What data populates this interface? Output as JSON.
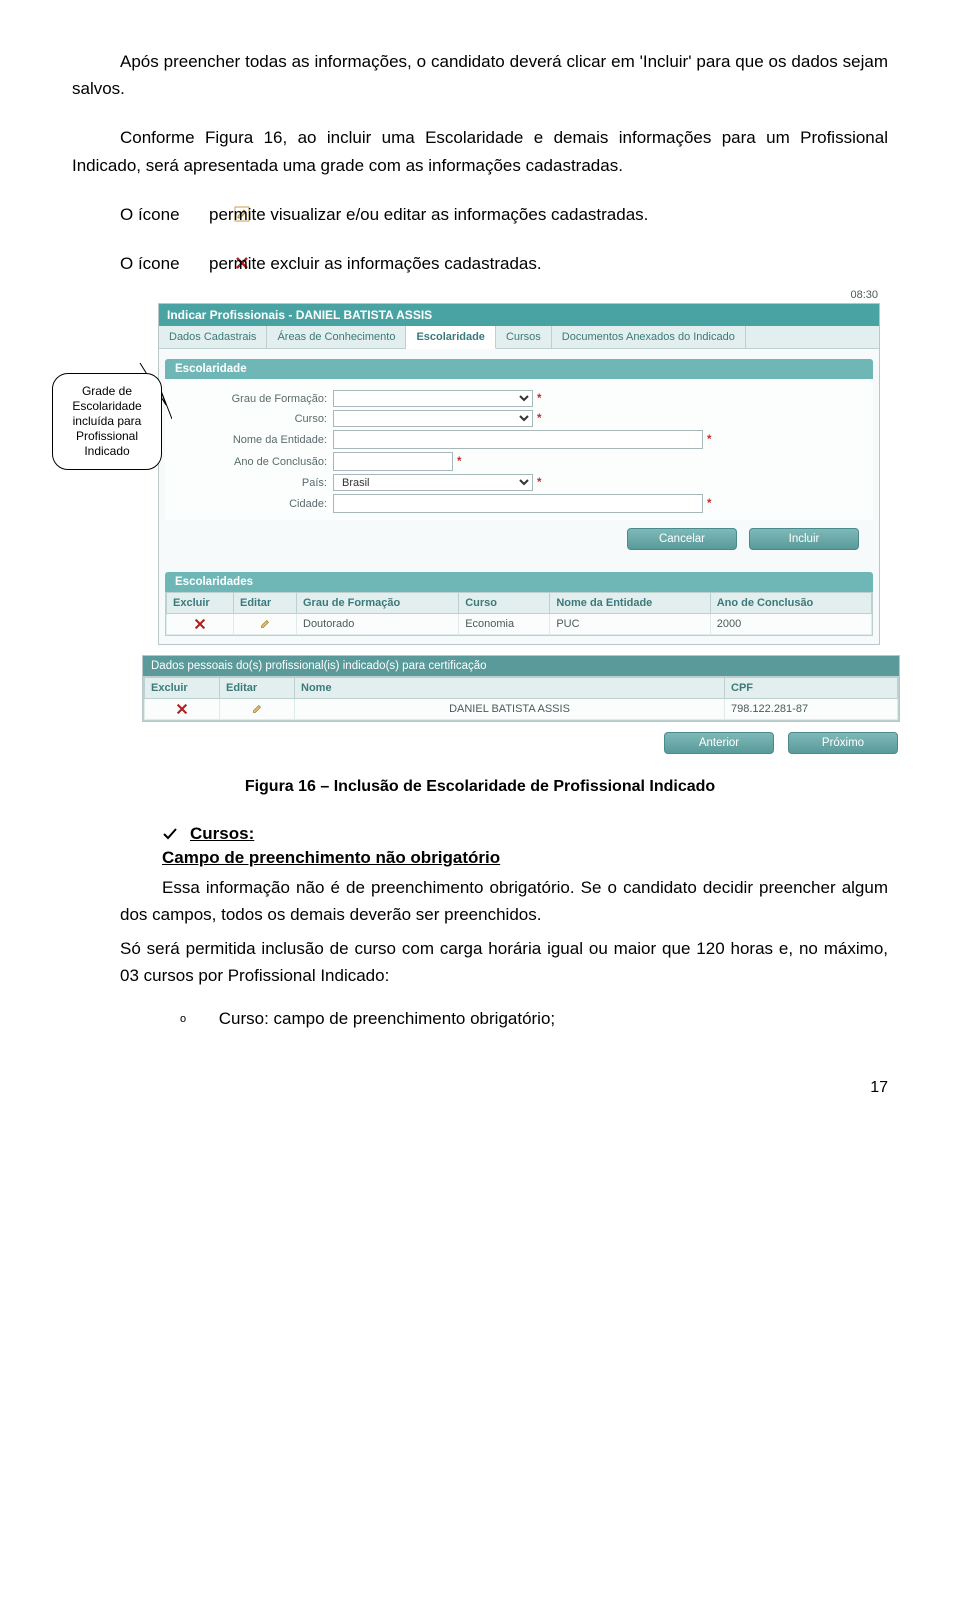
{
  "paragraphs": {
    "p1": "Após preencher todas as informações, o candidato deverá clicar em 'Incluir' para que os dados sejam salvos.",
    "p2": "Conforme Figura 16, ao incluir uma Escolaridade e demais informações para um Profissional Indicado, será apresentada uma grade com as informações cadastradas.",
    "p3a": "O ícone ",
    "p3b": " permite visualizar e/ou editar as informações cadastradas.",
    "p4a": "O ícone ",
    "p4b": "permite excluir as informações cadastradas."
  },
  "callout": "Grade de Escolaridade incluída para Profissional Indicado",
  "timestamp": "08:30",
  "window_title": "Indicar Profissionais - DANIEL BATISTA ASSIS",
  "tabs": [
    "Dados Cadastrais",
    "Áreas de Conhecimento",
    "Escolaridade",
    "Cursos",
    "Documentos Anexados do Indicado"
  ],
  "active_tab_index": 2,
  "section1": "Escolaridade",
  "form": {
    "grau_label": "Grau de Formação:",
    "curso_label": "Curso:",
    "entidade_label": "Nome da Entidade:",
    "ano_label": "Ano de Conclusão:",
    "pais_label": "País:",
    "cidade_label": "Cidade:",
    "pais_value": "Brasil",
    "required": "*"
  },
  "buttons": {
    "cancelar": "Cancelar",
    "incluir": "Incluir",
    "anterior": "Anterior",
    "proximo": "Próximo"
  },
  "section2": "Escolaridades",
  "grid_headers": [
    "Excluir",
    "Editar",
    "Grau de Formação",
    "Curso",
    "Nome da Entidade",
    "Ano de Conclusão"
  ],
  "grid_row": {
    "grau": "Doutorado",
    "curso": "Economia",
    "entidade": "PUC",
    "ano": "2000"
  },
  "darkbar": "Dados pessoais do(s) profissional(is) indicado(s) para certificação",
  "grid2_headers": [
    "Excluir",
    "Editar",
    "Nome",
    "CPF"
  ],
  "grid2_row": {
    "nome": "DANIEL BATISTA ASSIS",
    "cpf": "798.122.281-87"
  },
  "caption": "Figura 16 – Inclusão de Escolaridade de Profissional Indicado",
  "cursos_heading": "Cursos:",
  "cursos_sub": "Campo de preenchimento não obrigatório",
  "cursos_body1": "Essa informação não é de preenchimento obrigatório. Se o candidato decidir preencher algum dos campos, todos os demais deverão ser preenchidos.",
  "cursos_body2": "Só será permitida inclusão de curso com carga horária igual ou maior que 120 horas e, no máximo, 03 cursos por Profissional Indicado:",
  "bullet": "Curso: campo de preenchimento obrigatório;",
  "bullet_marker": "o",
  "page_number": "17"
}
